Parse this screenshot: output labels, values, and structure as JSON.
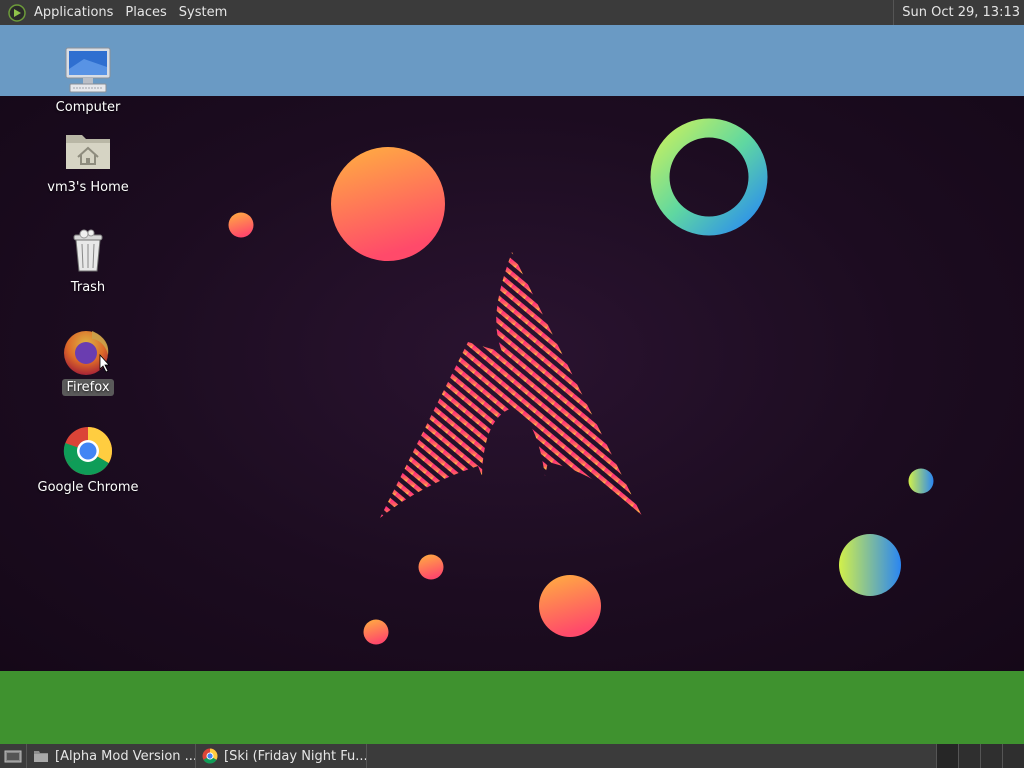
{
  "top_panel": {
    "menus": [
      "Applications",
      "Places",
      "System"
    ],
    "clock": "Sun Oct 29, 13:13"
  },
  "desktop": {
    "icons": [
      {
        "label": "Computer",
        "icon": "computer-icon"
      },
      {
        "label": "vm3's Home",
        "icon": "home-folder-icon"
      },
      {
        "label": "Trash",
        "icon": "trash-icon"
      },
      {
        "label": "Firefox",
        "icon": "firefox-icon",
        "selected": true
      },
      {
        "label": "Google Chrome",
        "icon": "chrome-icon"
      }
    ]
  },
  "taskbar": {
    "tasks": [
      {
        "title": "[Alpha Mod Version ...",
        "icon": "folder-icon"
      },
      {
        "title": "[Ski (Friday Night Fu...",
        "icon": "chrome-icon"
      }
    ],
    "workspaces": 4
  },
  "colors": {
    "panel": "#3b3b3b",
    "band_top": "#6a9ac4",
    "band_bottom": "#3f922f",
    "wallpaper": "#1c0c20"
  }
}
